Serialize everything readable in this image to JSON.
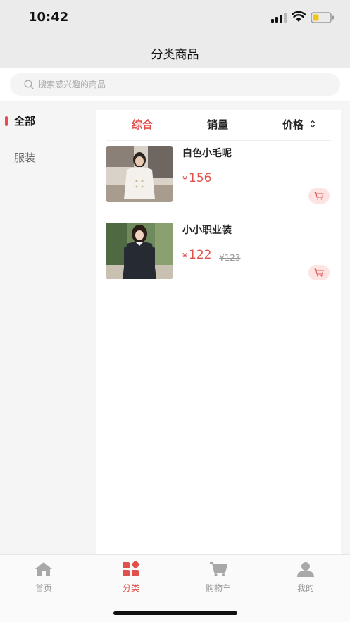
{
  "status_bar": {
    "time": "10:42"
  },
  "header": {
    "title": "分类商品"
  },
  "search": {
    "placeholder": "搜索感兴趣的商品"
  },
  "sidebar": {
    "items": [
      {
        "label": "全部",
        "active": true
      },
      {
        "label": "服装",
        "active": false
      }
    ]
  },
  "sort": {
    "tabs": [
      "综合",
      "销量",
      "价格"
    ]
  },
  "products": [
    {
      "name": "白色小毛呢",
      "currency": "¥",
      "price": "156",
      "original_price": ""
    },
    {
      "name": "小小职业装",
      "currency": "¥",
      "price": "122",
      "original_price": "¥123"
    }
  ],
  "tabbar": {
    "items": [
      {
        "label": "首页",
        "icon": "home-icon"
      },
      {
        "label": "分类",
        "icon": "category-icon"
      },
      {
        "label": "购物车",
        "icon": "cart-icon"
      },
      {
        "label": "我的",
        "icon": "user-icon"
      }
    ]
  },
  "colors": {
    "accent": "#e0514d",
    "background": "#f5f5f5",
    "cart_bg": "#fde3e1"
  }
}
